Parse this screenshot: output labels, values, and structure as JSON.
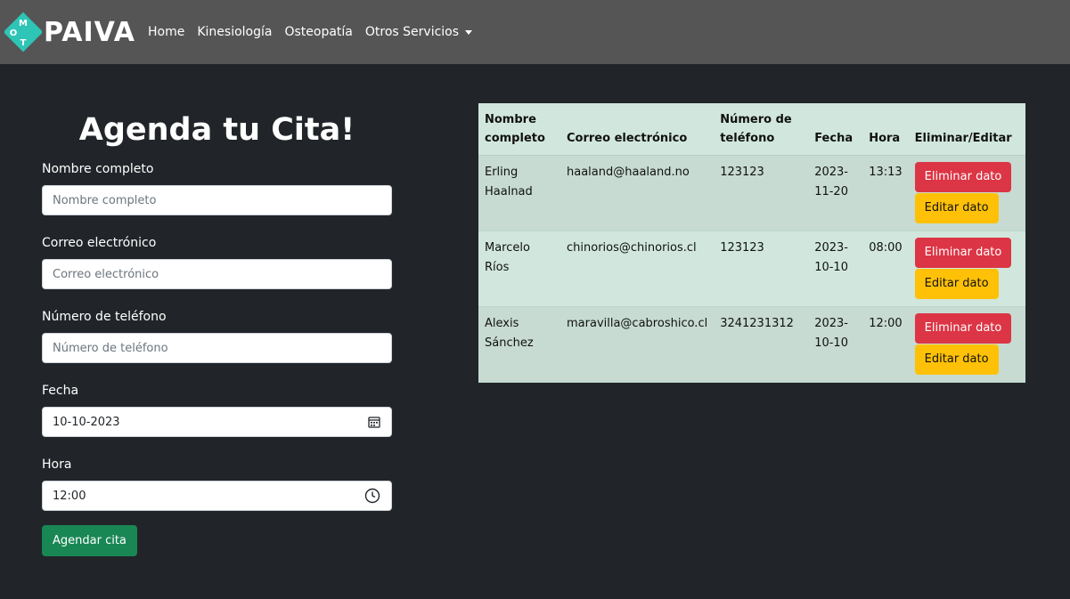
{
  "navbar": {
    "brand_text": "PAIVA",
    "logo_letters": [
      "O",
      "M",
      "T"
    ],
    "links": [
      "Home",
      "Kinesiología",
      "Osteopatía",
      "Otros Servicios"
    ],
    "accent_color": "#2ec4b6"
  },
  "form": {
    "title": "Agenda tu Cita!",
    "fields": [
      {
        "label": "Nombre completo",
        "placeholder": "Nombre completo",
        "value": ""
      },
      {
        "label": "Correo electrónico",
        "placeholder": "Correo electrónico",
        "value": ""
      },
      {
        "label": "Número de teléfono",
        "placeholder": "Número de teléfono",
        "value": ""
      },
      {
        "label": "Fecha",
        "placeholder": "",
        "value": "10-10-2023"
      },
      {
        "label": "Hora",
        "placeholder": "",
        "value": "12:00"
      }
    ],
    "submit_label": "Agendar cita"
  },
  "table": {
    "headers": [
      "Nombre completo",
      "Correo electrónico",
      "Número de teléfono",
      "Fecha",
      "Hora",
      "Eliminar/Editar"
    ],
    "rows": [
      {
        "nombre": "Erling Haalnad",
        "correo": "haaland@haaland.no",
        "telefono": "123123",
        "fecha": "2023-11-20",
        "hora": "13:13"
      },
      {
        "nombre": "Marcelo Ríos",
        "correo": "chinorios@chinorios.cl",
        "telefono": "123123",
        "fecha": "2023-10-10",
        "hora": "08:00"
      },
      {
        "nombre": "Alexis Sánchez",
        "correo": "maravilla@cabroshico.cl",
        "telefono": "3241231312",
        "fecha": "2023-10-10",
        "hora": "12:00"
      }
    ],
    "delete_label": "Eliminar dato",
    "edit_label": "Editar dato"
  }
}
